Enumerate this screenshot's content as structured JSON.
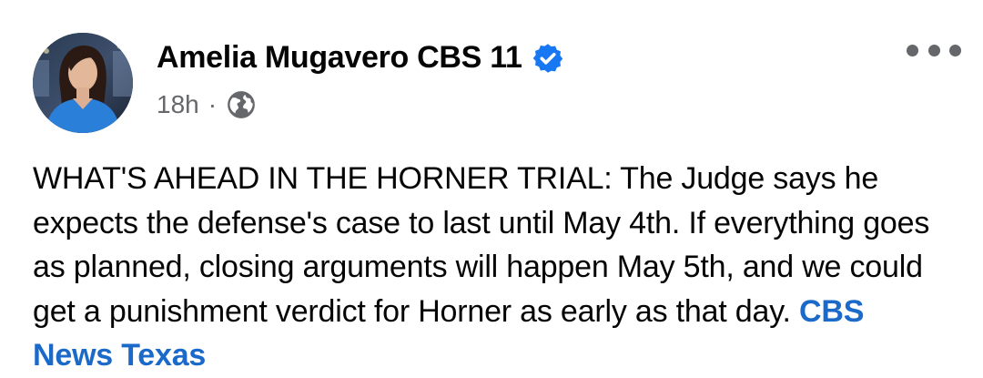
{
  "author": {
    "name": "Amelia Mugavero CBS 11",
    "verified_icon": "verified-badge-icon"
  },
  "meta": {
    "time": "18h",
    "separator": "·",
    "audience_icon": "globe-icon"
  },
  "post": {
    "text": "WHAT'S AHEAD IN THE HORNER TRIAL: The Judge says he expects the defense's case to last until May 4th. If everything goes as planned, closing arguments will happen May 5th, and we could get a punishment verdict for Horner as early as that day.",
    "link_text": "CBS News Texas"
  },
  "colors": {
    "link": "#1b6ac9",
    "verified": "#1877f2",
    "meta": "#65676b"
  }
}
